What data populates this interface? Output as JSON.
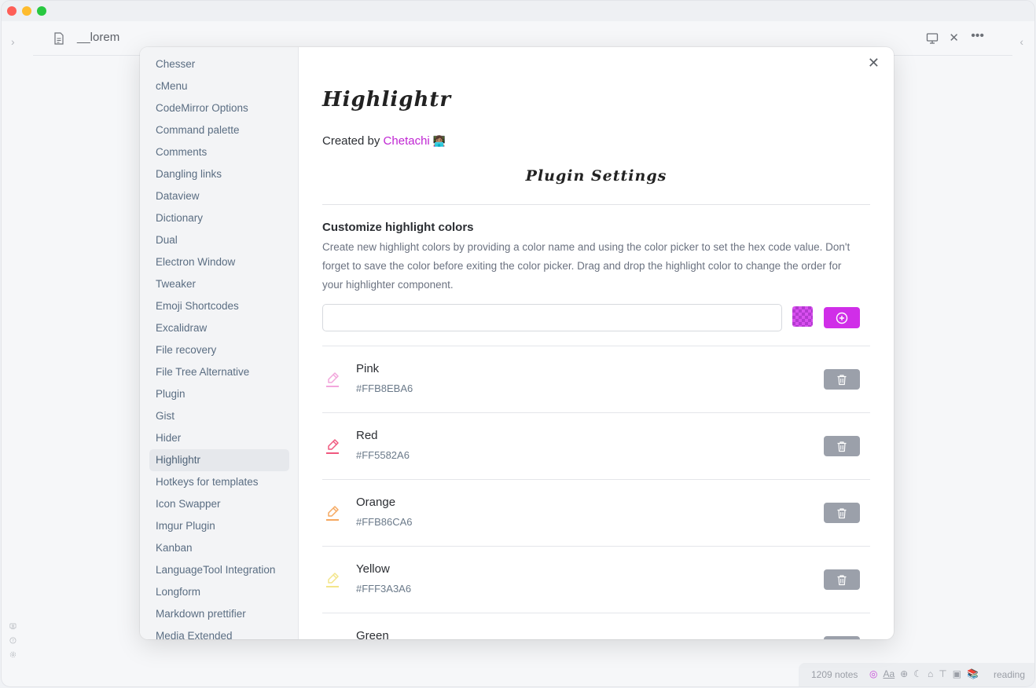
{
  "tab": {
    "title": "__lorem"
  },
  "status": {
    "notes": "1209 notes",
    "aa": "Aa",
    "reading": "reading"
  },
  "sidebar": {
    "items": [
      "Chesser",
      "cMenu",
      "CodeMirror Options",
      "Command palette",
      "Comments",
      "Dangling links",
      "Dataview",
      "Dictionary",
      "Dual",
      "Electron Window",
      "Tweaker",
      "Emoji Shortcodes",
      "Excalidraw",
      "File recovery",
      "File Tree Alternative",
      "Plugin",
      "Gist",
      "Hider",
      "Highlightr",
      "Hotkeys for templates",
      "Icon Swapper",
      "Imgur Plugin",
      "Kanban",
      "LanguageTool Integration",
      "Longform",
      "Markdown prettifier",
      "Media Extended"
    ],
    "active": "Highlightr"
  },
  "plugin": {
    "logo": "Highlightr",
    "created_prefix": "Created by ",
    "author": "Chetachi",
    "author_emoji": "👩🏽‍💻",
    "settings_heading": "Plugin Settings"
  },
  "section": {
    "title": "Customize highlight colors",
    "description": "Create new highlight colors by providing a color name and using the color picker to set the hex code value. Don't forget to save the color before exiting the color picker. Drag and drop the highlight color to change the order for your highlighter component.",
    "input_placeholder": ""
  },
  "colors": [
    {
      "name": "Pink",
      "hex": "#FFB8EBA6",
      "icon_color": "#f2a6dc"
    },
    {
      "name": "Red",
      "hex": "#FF5582A6",
      "icon_color": "#f0587f"
    },
    {
      "name": "Orange",
      "hex": "#FFB86CA6",
      "icon_color": "#f5a860"
    },
    {
      "name": "Yellow",
      "hex": "#FFF3A3A6",
      "icon_color": "#f3e58a"
    },
    {
      "name": "Green",
      "hex": "",
      "icon_color": "#7fdb9a"
    }
  ],
  "accent": "#d02ee8"
}
